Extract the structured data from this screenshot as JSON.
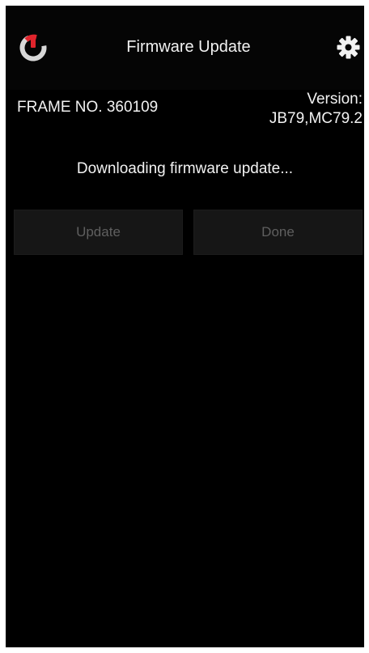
{
  "header": {
    "title": "Firmware Update",
    "icons": {
      "left": "power-icon",
      "right": "gear-icon"
    }
  },
  "info": {
    "frame_no": "FRAME NO. 360109",
    "version_label": "Version:",
    "version_value": "JB79,MC79.2"
  },
  "status": {
    "message": "Downloading firmware update..."
  },
  "buttons": {
    "update_label": "Update",
    "done_label": "Done",
    "update_enabled": false,
    "done_enabled": false
  },
  "colors": {
    "background": "#000000",
    "text": "#f2f2f2",
    "power_accent": "#e0242c",
    "button_bg": "#161616",
    "button_text_disabled": "#5f5f5f"
  }
}
